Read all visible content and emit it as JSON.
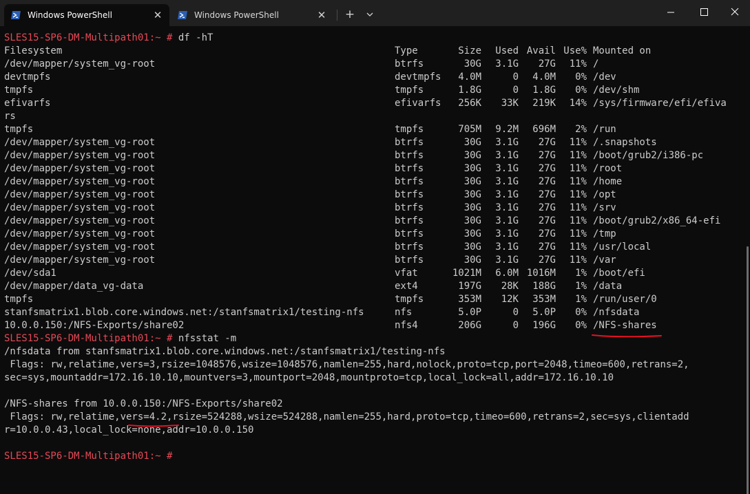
{
  "tabs": [
    {
      "title": "Windows PowerShell",
      "active": true
    },
    {
      "title": "Windows PowerShell",
      "active": false
    }
  ],
  "tab_close_glyph": "✕",
  "new_tab_glyph": "+",
  "colors": {
    "prompt": "#e74856",
    "text": "#cccccc",
    "background": "#0c0c0c",
    "annotation": "#e81123"
  },
  "terminal": {
    "prompt": "SLES15-SP6-DM-Multipath01:~ #",
    "command1": "df -hT",
    "df_header": {
      "fs": "Filesystem",
      "type": "Type",
      "size": "Size",
      "used": "Used",
      "avail": "Avail",
      "use": "Use%",
      "mount": "Mounted on"
    },
    "df_rows": [
      {
        "fs": "/dev/mapper/system_vg-root",
        "type": "btrfs",
        "size": "30G",
        "used": "3.1G",
        "avail": "27G",
        "use": "11%",
        "mount": "/"
      },
      {
        "fs": "devtmpfs",
        "type": "devtmpfs",
        "size": "4.0M",
        "used": "0",
        "avail": "4.0M",
        "use": "0%",
        "mount": "/dev"
      },
      {
        "fs": "tmpfs",
        "type": "tmpfs",
        "size": "1.8G",
        "used": "0",
        "avail": "1.8G",
        "use": "0%",
        "mount": "/dev/shm"
      },
      {
        "fs": "efivarfs",
        "type": "efivarfs",
        "size": "256K",
        "used": "33K",
        "avail": "219K",
        "use": "14%",
        "mount": "/sys/firmware/efi/efiva"
      },
      {
        "fs": "rs",
        "type": "",
        "size": "",
        "used": "",
        "avail": "",
        "use": "",
        "mount": ""
      },
      {
        "fs": "tmpfs",
        "type": "tmpfs",
        "size": "705M",
        "used": "9.2M",
        "avail": "696M",
        "use": "2%",
        "mount": "/run"
      },
      {
        "fs": "/dev/mapper/system_vg-root",
        "type": "btrfs",
        "size": "30G",
        "used": "3.1G",
        "avail": "27G",
        "use": "11%",
        "mount": "/.snapshots"
      },
      {
        "fs": "/dev/mapper/system_vg-root",
        "type": "btrfs",
        "size": "30G",
        "used": "3.1G",
        "avail": "27G",
        "use": "11%",
        "mount": "/boot/grub2/i386-pc"
      },
      {
        "fs": "/dev/mapper/system_vg-root",
        "type": "btrfs",
        "size": "30G",
        "used": "3.1G",
        "avail": "27G",
        "use": "11%",
        "mount": "/root"
      },
      {
        "fs": "/dev/mapper/system_vg-root",
        "type": "btrfs",
        "size": "30G",
        "used": "3.1G",
        "avail": "27G",
        "use": "11%",
        "mount": "/home"
      },
      {
        "fs": "/dev/mapper/system_vg-root",
        "type": "btrfs",
        "size": "30G",
        "used": "3.1G",
        "avail": "27G",
        "use": "11%",
        "mount": "/opt"
      },
      {
        "fs": "/dev/mapper/system_vg-root",
        "type": "btrfs",
        "size": "30G",
        "used": "3.1G",
        "avail": "27G",
        "use": "11%",
        "mount": "/srv"
      },
      {
        "fs": "/dev/mapper/system_vg-root",
        "type": "btrfs",
        "size": "30G",
        "used": "3.1G",
        "avail": "27G",
        "use": "11%",
        "mount": "/boot/grub2/x86_64-efi"
      },
      {
        "fs": "/dev/mapper/system_vg-root",
        "type": "btrfs",
        "size": "30G",
        "used": "3.1G",
        "avail": "27G",
        "use": "11%",
        "mount": "/tmp"
      },
      {
        "fs": "/dev/mapper/system_vg-root",
        "type": "btrfs",
        "size": "30G",
        "used": "3.1G",
        "avail": "27G",
        "use": "11%",
        "mount": "/usr/local"
      },
      {
        "fs": "/dev/mapper/system_vg-root",
        "type": "btrfs",
        "size": "30G",
        "used": "3.1G",
        "avail": "27G",
        "use": "11%",
        "mount": "/var"
      },
      {
        "fs": "/dev/sda1",
        "type": "vfat",
        "size": "1021M",
        "used": "6.0M",
        "avail": "1016M",
        "use": "1%",
        "mount": "/boot/efi"
      },
      {
        "fs": "/dev/mapper/data_vg-data",
        "type": "ext4",
        "size": "197G",
        "used": "28K",
        "avail": "188G",
        "use": "1%",
        "mount": "/data"
      },
      {
        "fs": "tmpfs",
        "type": "tmpfs",
        "size": "353M",
        "used": "12K",
        "avail": "353M",
        "use": "1%",
        "mount": "/run/user/0"
      },
      {
        "fs": "stanfsmatrix1.blob.core.windows.net:/stanfsmatrix1/testing-nfs",
        "type": "nfs",
        "size": "5.0P",
        "used": "0",
        "avail": "5.0P",
        "use": "0%",
        "mount": "/nfsdata"
      },
      {
        "fs": "10.0.0.150:/NFS-Exports/share02",
        "type": "nfs4",
        "size": "206G",
        "used": "0",
        "avail": "196G",
        "use": "0%",
        "mount": "/NFS-shares"
      }
    ],
    "command2": "nfsstat -m",
    "nfsstat_lines": [
      "/nfsdata from stanfsmatrix1.blob.core.windows.net:/stanfsmatrix1/testing-nfs",
      " Flags: rw,relatime,vers=3,rsize=1048576,wsize=1048576,namlen=255,hard,nolock,proto=tcp,port=2048,timeo=600,retrans=2,",
      "sec=sys,mountaddr=172.16.10.10,mountvers=3,mountport=2048,mountproto=tcp,local_lock=all,addr=172.16.10.10",
      "",
      "/NFS-shares from 10.0.0.150:/NFS-Exports/share02",
      " Flags: rw,relatime,vers=4.2,rsize=524288,wsize=524288,namlen=255,hard,proto=tcp,timeo=600,retrans=2,sec=sys,clientadd",
      "r=10.0.0.43,local_lock=none,addr=10.0.0.150"
    ]
  }
}
